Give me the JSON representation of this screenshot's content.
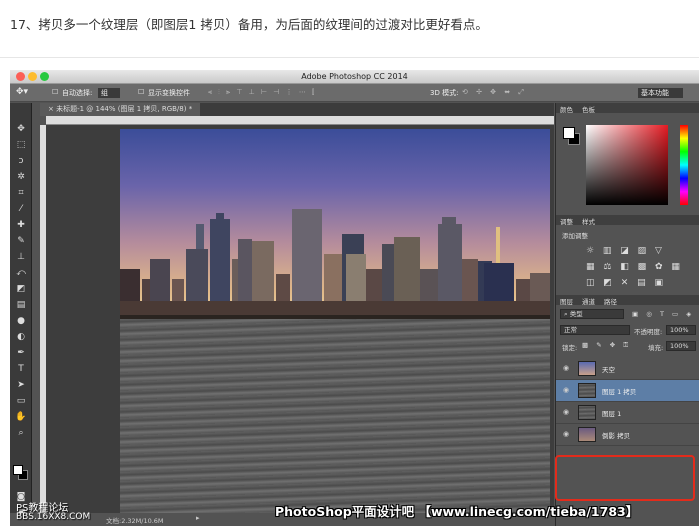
{
  "caption": "17、拷贝多一个纹理层（即图层1 拷贝）备用，为后面的纹理间的过渡对比更好看点。",
  "app": {
    "title": "Adobe Photoshop CC 2014"
  },
  "options_bar": {
    "auto_select_label": "自动选择:",
    "auto_select_value": "组",
    "show_transform_label": "显示变换控件",
    "mode_3d_label": "3D 模式:",
    "workspace_value": "基本功能"
  },
  "document": {
    "tab_label": "未标题-1 @ 144% (图层 1 拷贝, RGB/8) *"
  },
  "status": {
    "doc_size": "文档:2.32M/10.6M"
  },
  "panels": {
    "color_tabs": [
      "颜色",
      "色板"
    ],
    "adjust_tabs": [
      "调整",
      "样式"
    ],
    "add_adjustment": "添加调整",
    "layer_tabs": [
      "图层",
      "通道",
      "路径"
    ],
    "kind_filter": "类型",
    "blend_mode": "正常",
    "opacity_label": "不透明度:",
    "opacity_value": "100%",
    "lock_label": "锁定:",
    "fill_label": "填充:",
    "fill_value": "100%"
  },
  "layers": [
    {
      "name": "天空",
      "selected": false
    },
    {
      "name": "图层 1 拷贝",
      "selected": true
    },
    {
      "name": "图层 1",
      "selected": false
    },
    {
      "name": "倒影 拷贝",
      "selected": false
    }
  ],
  "watermark": {
    "text": "PhotoShop平面设计吧 【www.linecg.com/tieba/1783】"
  },
  "forum": {
    "line1": "PS教程论坛",
    "line2": "BBS.16XX8.COM"
  },
  "colors": {
    "highlight": "#e32b1b",
    "selected_layer": "#5d7ea6",
    "ui_gray": "#535353"
  }
}
